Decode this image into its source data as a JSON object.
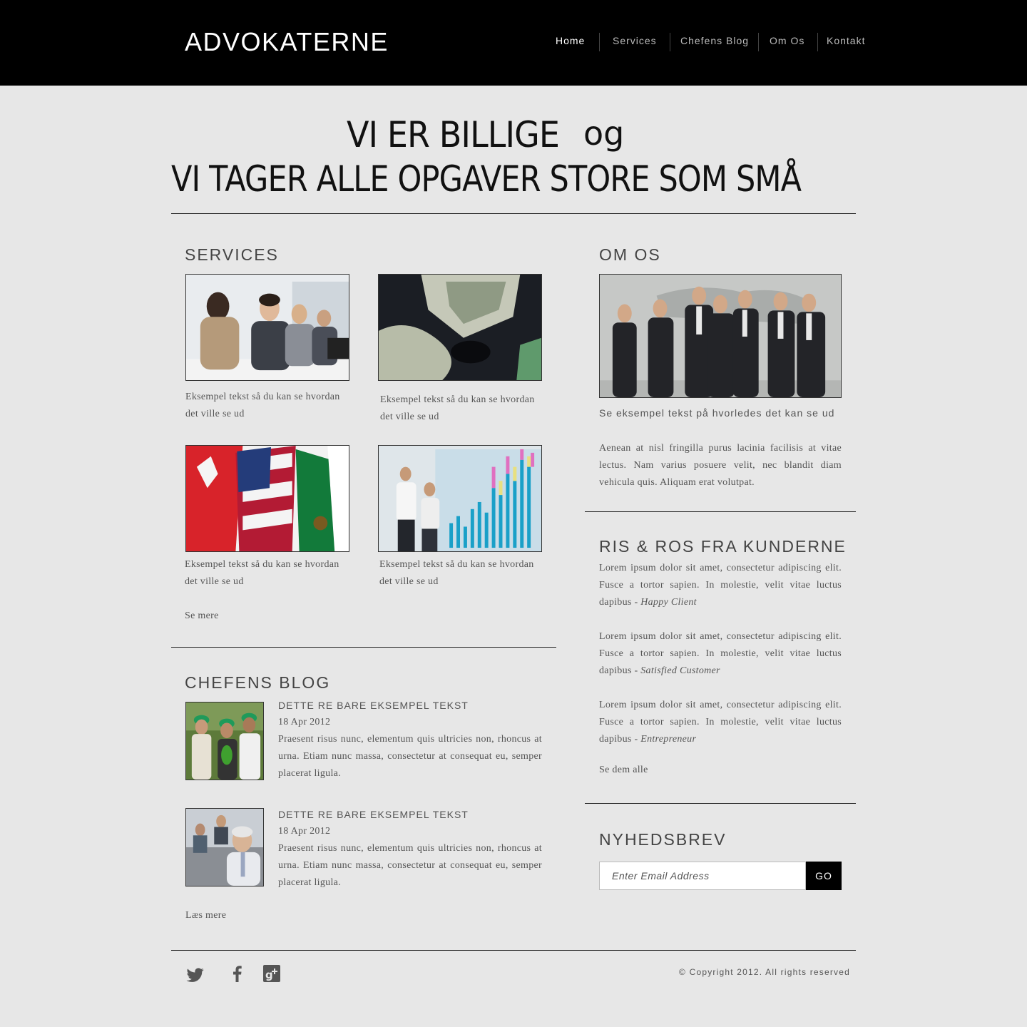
{
  "header": {
    "logo": "ADVOKATERNE",
    "nav": [
      "Home",
      "Services",
      "Chefens Blog",
      "Om Os",
      "Kontakt"
    ]
  },
  "hero": {
    "line1": "VI ER BILLIGE",
    "line1_og": "og",
    "line2": "VI TAGER ALLE OPGAVER STORE SOM SMÅ"
  },
  "services": {
    "title": "SERVICES",
    "items": [
      {
        "image": "call-center-photo",
        "caption": "Eksempel tekst så du kan se hvordan det ville se ud"
      },
      {
        "image": "money-puzzle-photo",
        "caption": "Eksempel tekst så du kan se hvordan det ville se ud"
      },
      {
        "image": "flags-photo",
        "caption": "Eksempel tekst så du kan se hvordan det ville se ud"
      },
      {
        "image": "presentation-chart-photo",
        "caption": "Eksempel tekst så du kan se hvordan det ville se ud"
      }
    ],
    "more": "Se mere"
  },
  "blog": {
    "title": "CHEFENS BLOG",
    "posts": [
      {
        "image": "hardhat-team-photo",
        "heading": "DETTE RE BARE EKSEMPEL TEKST",
        "date": "18 Apr 2012",
        "text": "Praesent risus nunc, elementum quis ultricies non, rhoncus at urna. Etiam nunc massa, consectetur at consequat eu, semper placerat ligula."
      },
      {
        "image": "businessman-office-photo",
        "heading": "DETTE RE BARE EKSEMPEL TEKST",
        "date": "18 Apr 2012",
        "text": "Praesent risus nunc, elementum quis ultricies non, rhoncus at urna. Etiam nunc massa, consectetur at consequat eu, semper placerat ligula."
      }
    ],
    "more": "Læs mere"
  },
  "om_os": {
    "title": "OM OS",
    "image": "business-team-photo",
    "subtitle": "Se eksempel tekst på hvorledes det kan se ud",
    "text": "Aenean at nisl fringilla purus lacinia facilisis at vitae lectus. Nam varius posuere velit, nec blandit diam vehicula quis. Aliquam erat volutpat."
  },
  "testimonials": {
    "title": "RIS & ROS FRA KUNDERNE",
    "items": [
      {
        "text": "Lorem ipsum dolor sit amet, consectetur adipiscing elit. Fusce a tortor sapien. In molestie, velit vitae luctus dapibus - ",
        "author": "Happy Client"
      },
      {
        "text": "Lorem ipsum dolor sit amet, consectetur adipiscing elit. Fusce a tortor sapien. In molestie, velit vitae luctus dapibus - ",
        "author": "Satisfied Customer"
      },
      {
        "text": "Lorem ipsum dolor sit amet, consectetur adipiscing elit. Fusce a tortor sapien. In molestie, velit vitae luctus dapibus - ",
        "author": "Entrepreneur"
      }
    ],
    "more": "Se dem alle"
  },
  "newsletter": {
    "title": "NYHEDSBREV",
    "placeholder": "Enter Email Address",
    "button": "GO"
  },
  "footer": {
    "social": [
      "twitter-icon",
      "facebook-icon",
      "google-plus-icon"
    ],
    "copyright": "© Copyright 2012. All rights reserved"
  },
  "colors": {
    "header_bg": "#000000",
    "page_bg": "#e7e7e7",
    "text": "#555555",
    "rule": "#222222"
  }
}
